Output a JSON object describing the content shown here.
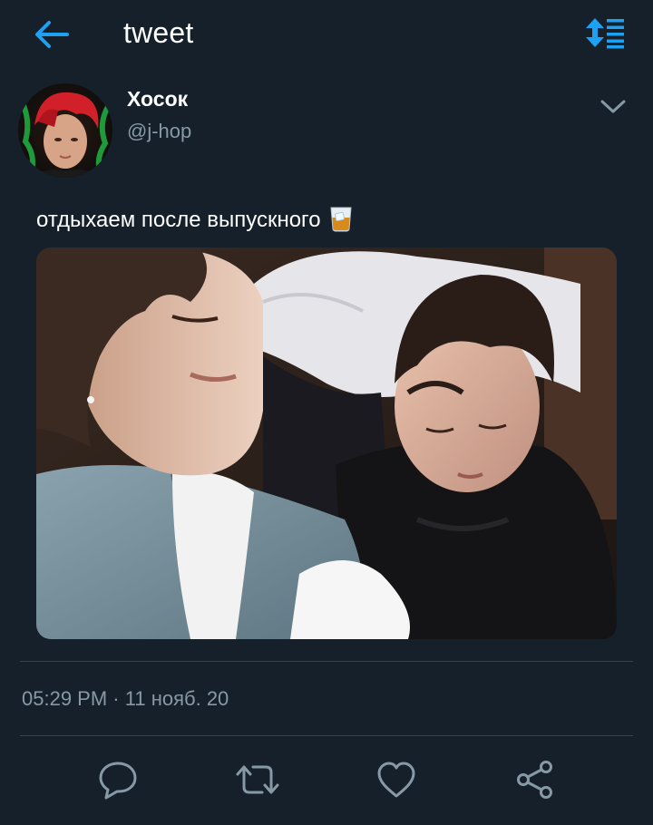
{
  "header": {
    "title": "tweet",
    "back_icon": "arrow-left-icon",
    "sort_icon": "sort-icon"
  },
  "tweet": {
    "author_name": "Хосок",
    "author_handle": "@j-hop",
    "text": "отдыхаем после выпускного",
    "text_emoji": "tumbler-glass-emoji",
    "timestamp_time": "05:29 PM",
    "timestamp_separator": "·",
    "timestamp_date": "11 нояб. 20"
  },
  "actions": {
    "reply_icon": "reply-icon",
    "retweet_icon": "retweet-icon",
    "like_icon": "heart-icon",
    "share_icon": "share-icon"
  },
  "colors": {
    "background": "#15202b",
    "accent": "#1da1f2",
    "secondary_text": "#8899a6",
    "divider": "#38444d"
  }
}
